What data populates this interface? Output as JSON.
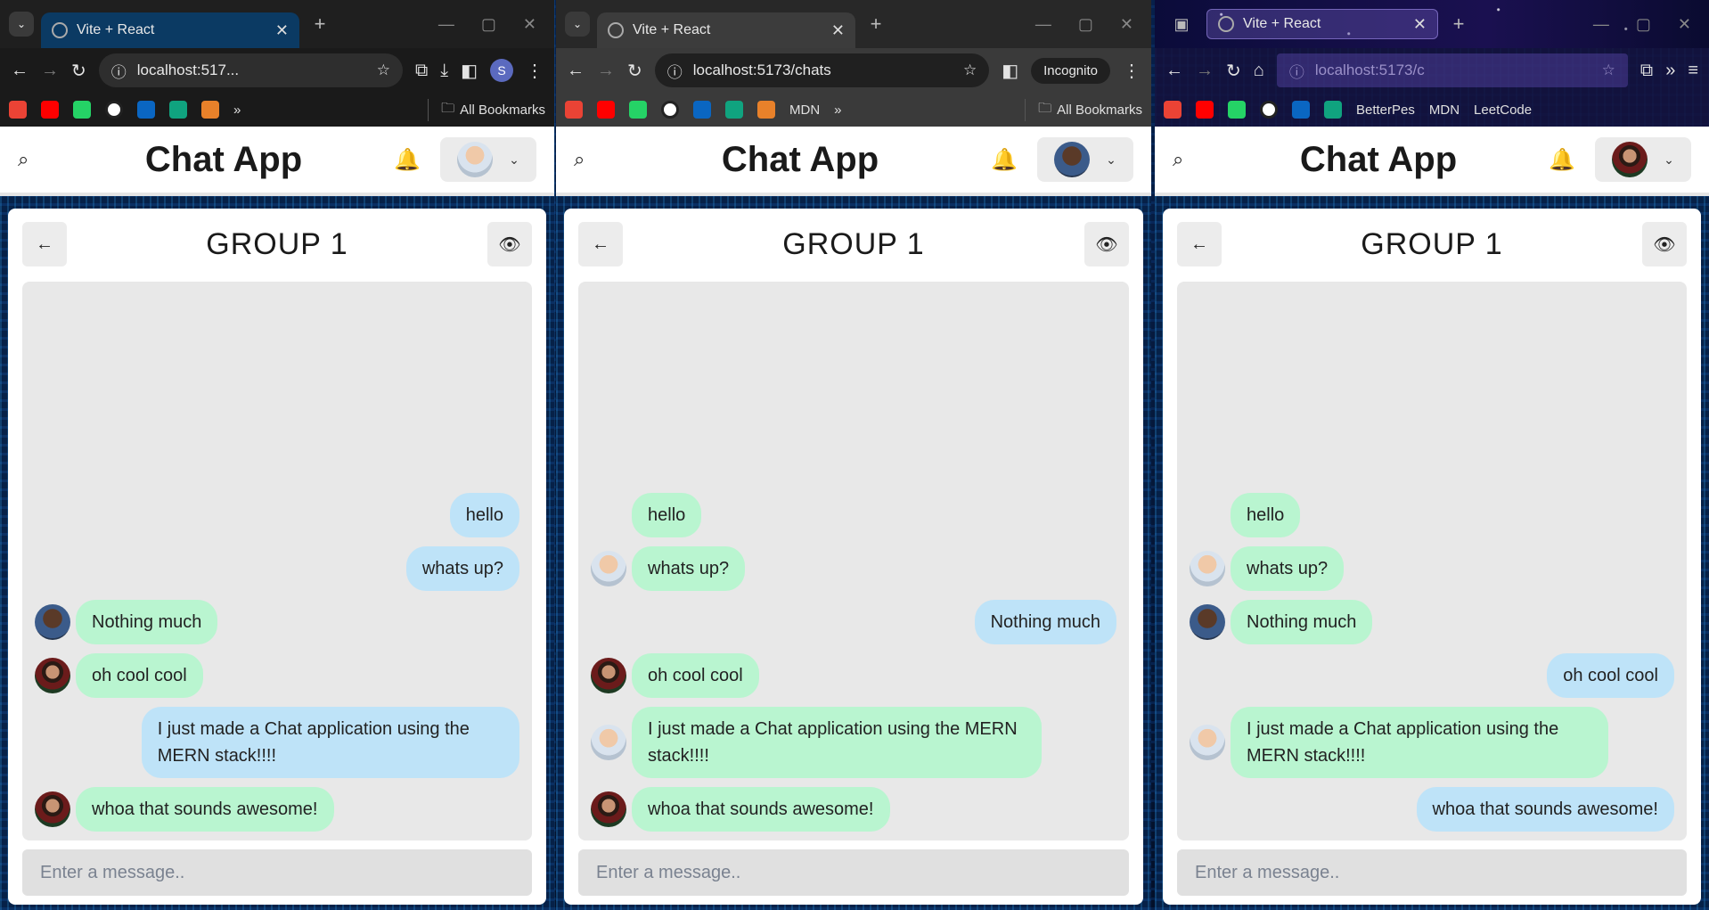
{
  "app": {
    "title": "Chat App",
    "group_name": "GROUP 1",
    "composer_placeholder": "Enter a message.."
  },
  "icons": {
    "search": "search-icon",
    "bell": "bell-icon",
    "back": "arrow-left-icon",
    "eye": "eye-icon",
    "chevron": "chevron-down-icon"
  },
  "colors": {
    "bubble_theirs": "#b9f5d0",
    "bubble_mine": "#bee3f8",
    "chat_area": "#e8e8e8"
  },
  "windows": [
    {
      "browser": "chrome",
      "tab_title": "Vite + React",
      "url": "localhost:517...",
      "profile_initial": "S",
      "bookmarks": [],
      "bookmarks_all": "All Bookmarks",
      "messages": [
        {
          "side": "mine",
          "text": "hello",
          "avatar": ""
        },
        {
          "side": "mine",
          "text": "whats up?",
          "avatar": ""
        },
        {
          "side": "theirs",
          "text": "Nothing much",
          "avatar": "dark"
        },
        {
          "side": "theirs",
          "text": "oh cool cool",
          "avatar": "beard"
        },
        {
          "side": "mine",
          "text": "I just made a Chat application using the MERN stack!!!!",
          "avatar": ""
        },
        {
          "side": "theirs",
          "text": "whoa that sounds awesome!",
          "avatar": "beard"
        }
      ]
    },
    {
      "browser": "chrome-incognito",
      "tab_title": "Vite + React",
      "url": "localhost:5173/chats",
      "incognito_label": "Incognito",
      "bookmarks": [
        "MDN"
      ],
      "bookmarks_all": "All Bookmarks",
      "messages": [
        {
          "side": "theirs",
          "text": "hello",
          "avatar": ""
        },
        {
          "side": "theirs",
          "text": "whats up?",
          "avatar": "bald"
        },
        {
          "side": "mine",
          "text": "Nothing much",
          "avatar": ""
        },
        {
          "side": "theirs",
          "text": "oh cool cool",
          "avatar": "beard"
        },
        {
          "side": "theirs",
          "text": "I just made a Chat application using the MERN stack!!!!",
          "avatar": "bald"
        },
        {
          "side": "theirs",
          "text": "whoa that sounds awesome!",
          "avatar": "beard"
        }
      ]
    },
    {
      "browser": "firefox",
      "tab_title": "Vite + React",
      "url": "localhost:5173/c",
      "bookmarks": [
        "BetterPes",
        "MDN",
        "LeetCode"
      ],
      "messages": [
        {
          "side": "theirs",
          "text": "hello",
          "avatar": ""
        },
        {
          "side": "theirs",
          "text": "whats up?",
          "avatar": "bald"
        },
        {
          "side": "theirs",
          "text": "Nothing much",
          "avatar": "dark"
        },
        {
          "side": "mine",
          "text": "oh cool cool",
          "avatar": ""
        },
        {
          "side": "theirs",
          "text": "I just made a Chat application using the MERN stack!!!!",
          "avatar": "bald"
        },
        {
          "side": "mine",
          "text": "whoa that sounds awesome!",
          "avatar": ""
        }
      ]
    }
  ],
  "header_avatars": [
    "bald",
    "dark",
    "beard"
  ]
}
